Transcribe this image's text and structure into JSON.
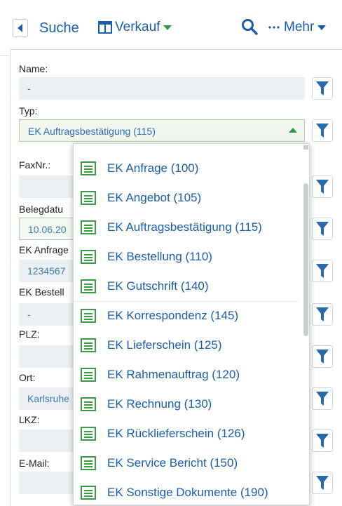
{
  "header": {
    "back_label": "Suche",
    "view_label": "Verkauf",
    "more_label": "Mehr"
  },
  "colors": {
    "accent": "#1a5ea8",
    "green": "#2e9a44",
    "filter": "#2a6aa8"
  },
  "form": {
    "name_label": "Name:",
    "name_value": "-",
    "typ_label": "Typ:",
    "typ_value": "EK Auftragsbestätigung (115)",
    "fax_label": "FaxNr.:",
    "belegdatum_label": "Belegdatu",
    "belegdatum_value": "10.06.20",
    "ek_anfrage_label": "EK Anfrage",
    "ek_anfrage_value": "1234567",
    "ek_bestell_label": "EK Bestell",
    "ek_bestell_value": "-",
    "plz_label": "PLZ:",
    "ort_label": "Ort:",
    "ort_value": "Karlsruhe",
    "lkz_label": "LKZ:",
    "email_label": "E-Mail:"
  },
  "dropdown": {
    "items": [
      {
        "label": "EK Anfrage (100)"
      },
      {
        "label": "EK Angebot (105)"
      },
      {
        "label": "EK Auftragsbestätigung (115)"
      },
      {
        "label": "EK Bestellung (110)"
      },
      {
        "label": "EK Gutschrift (140)"
      },
      {
        "label": "EK Korrespondenz (145)"
      },
      {
        "label": "EK Lieferschein (125)"
      },
      {
        "label": "EK Rahmenauftrag (120)"
      },
      {
        "label": "EK Rechnung (130)"
      },
      {
        "label": "EK Rücklieferschein (126)"
      },
      {
        "label": "EK Service Bericht (150)"
      },
      {
        "label": "EK Sonstige Dokumente (190)"
      }
    ]
  }
}
